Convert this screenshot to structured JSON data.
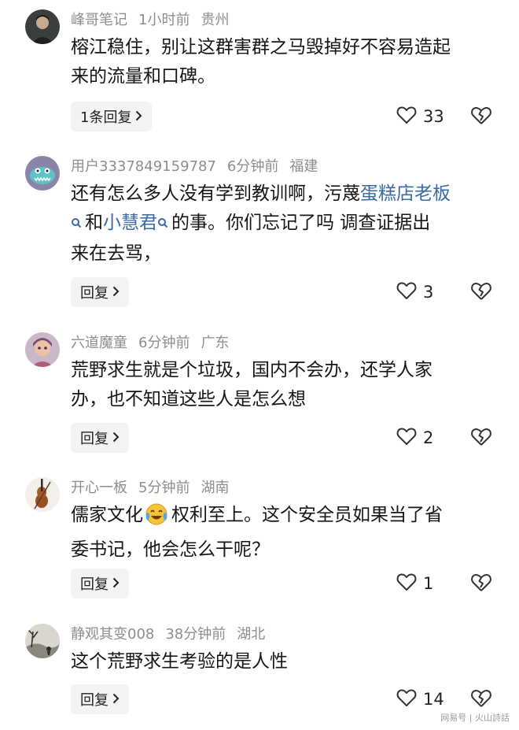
{
  "comments": [
    {
      "username": "峰哥笔记",
      "time": "1小时前",
      "location": "贵州",
      "lines": [
        "榕江稳住，别让这群害群之马毁掉好不容易造起",
        "来的流量和口碑。"
      ],
      "reply_label": "1条回复",
      "likes": "33"
    },
    {
      "username": "用户3337849159787",
      "time": "6分钟前",
      "location": "福建",
      "line1_prefix": "还有怎么多人没有学到教训啊，污蔑",
      "link1": "蛋糕店老板",
      "line2_mid": "和",
      "link2": "小慧君",
      "line2_suffix": "的事。你们忘记了吗 调查证据出",
      "line3": "来在去骂，",
      "reply_label": "回复",
      "likes": "3"
    },
    {
      "username": "六道魔童",
      "time": "6分钟前",
      "location": "广东",
      "lines": [
        "荒野求生就是个垃圾，国内不会办，还学人家",
        "办，也不知道这些人是怎么想"
      ],
      "reply_label": "回复",
      "likes": "2"
    },
    {
      "username": "开心一板",
      "time": "5分钟前",
      "location": "湖南",
      "line1_prefix": "儒家文化",
      "line1_suffix": "权利至上。这个安全员如果当了省",
      "line2": "委书记，他会怎么干呢？",
      "reply_label": "回复",
      "likes": "1"
    },
    {
      "username": "静观其变008",
      "time": "38分钟前",
      "location": "湖北",
      "lines": [
        "这个荒野求生考验的是人性"
      ],
      "reply_label": "回复",
      "likes": "14"
    }
  ],
  "watermark": "网易号 | 火山詩話",
  "icons": {
    "like": "heart-outline-icon",
    "dislike": "broken-heart-icon",
    "reply_arrow": "chevron-right-icon",
    "emoji": "crying-laughing-emoji",
    "search": "search-icon"
  }
}
